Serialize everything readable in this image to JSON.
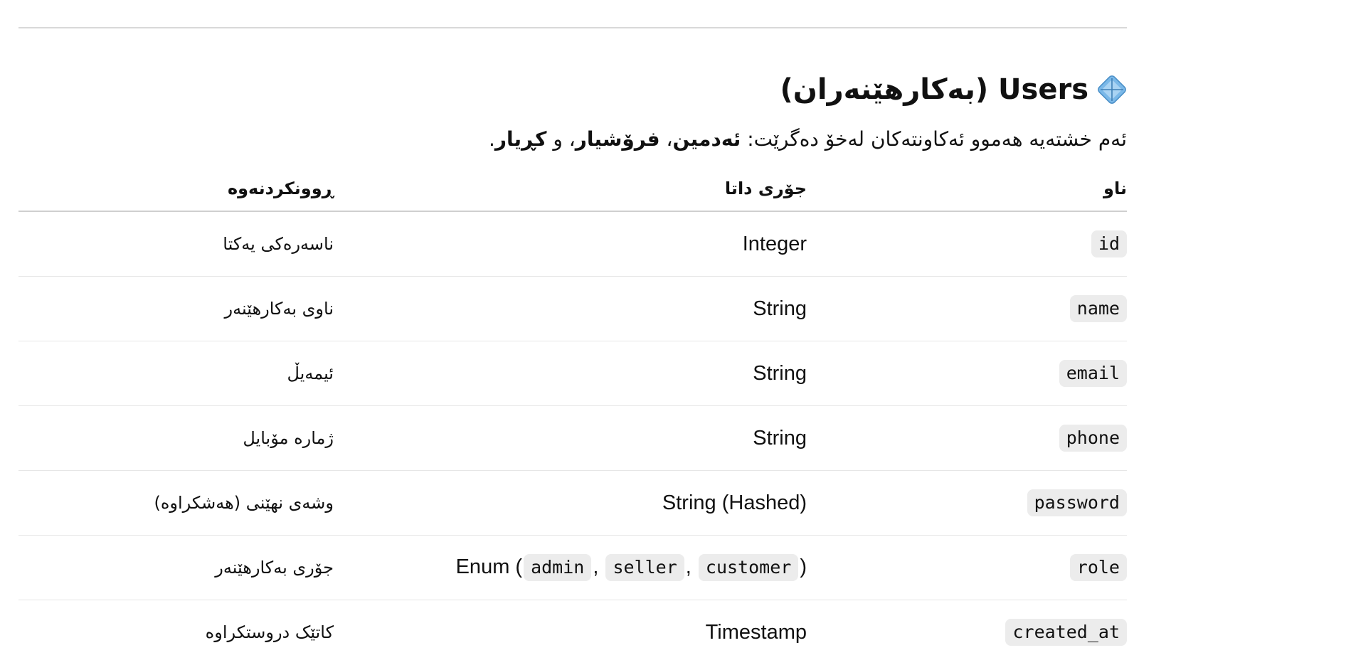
{
  "section": {
    "title": "Users (بەکارهێنەران)",
    "icon": "diamond-icon",
    "lead_prefix": "ئەم خشتەیە هەموو ئەکاونتەکان لەخۆ دەگرێت: ",
    "role_admin": "ئەدمین",
    "separator_1": "، ",
    "role_seller": "فرۆشیار",
    "separator_2": "، و ",
    "role_customer": "کڕیار",
    "lead_suffix": "."
  },
  "table": {
    "headers": {
      "name": "ناو",
      "type": "جۆری داتا",
      "description": "ڕوونکردنەوە"
    },
    "rows": [
      {
        "name": "id",
        "type": "Integer",
        "description": "ناسەرەکی یەکتا"
      },
      {
        "name": "name",
        "type": "String",
        "description": "ناوی بەکارهێنەر"
      },
      {
        "name": "email",
        "type": "String",
        "description": "ئیمەیڵ"
      },
      {
        "name": "phone",
        "type": "String",
        "description": "ژمارە مۆبایل"
      },
      {
        "name": "password",
        "type": "String (Hashed)",
        "description": "وشەی نهێنی (هەشکراوە)"
      },
      {
        "name": "role",
        "type_prefix": "Enum (",
        "type_values": [
          "admin",
          "seller",
          "customer"
        ],
        "type_separator": ",",
        "type_suffix": ")",
        "description": "جۆری بەکارهێنەر"
      },
      {
        "name": "created_at",
        "type": "Timestamp",
        "description": "کاتێک دروستکراوە"
      }
    ]
  },
  "colors": {
    "code_background": "#ececec",
    "rule": "#d9d9d9",
    "text": "#111111",
    "icon_fill": "#7ab8e8"
  }
}
